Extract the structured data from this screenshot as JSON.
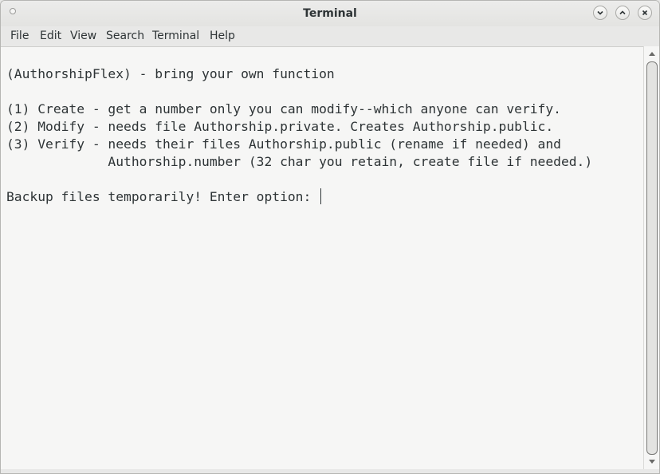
{
  "window": {
    "title": "Terminal"
  },
  "menubar": {
    "items": [
      "File",
      "Edit",
      "View",
      "Search",
      "Terminal",
      "Help"
    ]
  },
  "terminal": {
    "lines": [
      "(AuthorshipFlex) - bring your own function",
      "(1) Create - get a number only you can modify--which anyone can verify.",
      "(2) Modify - needs file Authorship.private. Creates Authorship.public.",
      "(3) Verify - needs their files Authorship.public (rename if needed) and",
      "             Authorship.number (32 char you retain, create file if needed.)",
      "Backup files temporarily! Enter option: "
    ]
  },
  "icons": {
    "window_menu": "window-menu-dot-icon",
    "minimize": "chevron-down-icon",
    "maximize": "chevron-up-icon",
    "close": "close-icon"
  }
}
